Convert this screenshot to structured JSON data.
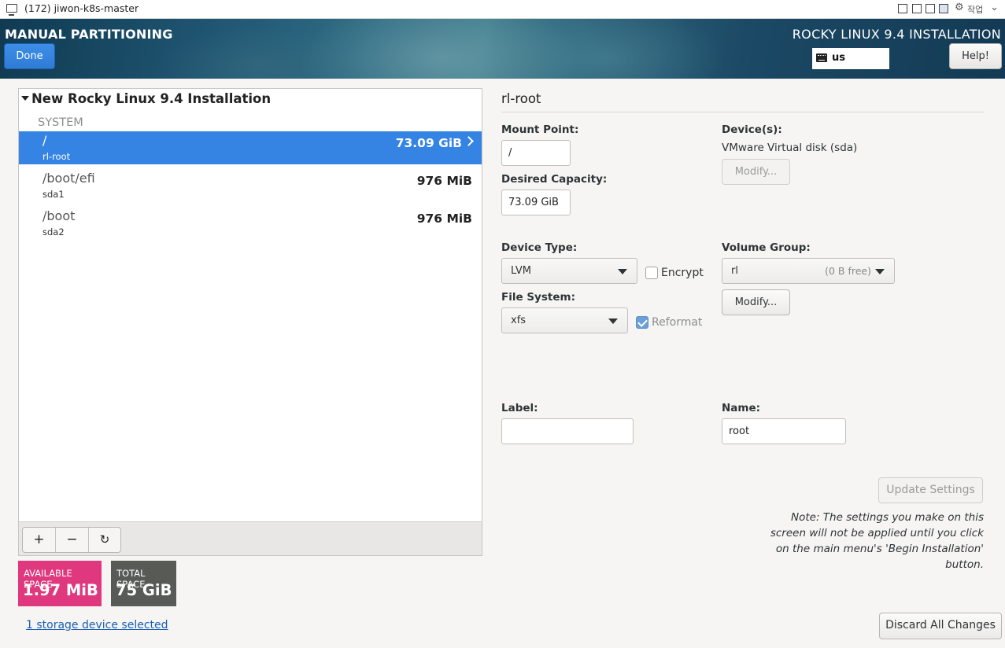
{
  "vm_window": {
    "title": "(172) jiwon-k8s-master",
    "menu_text": "작업"
  },
  "header": {
    "page_title": "MANUAL PARTITIONING",
    "done_label": "Done",
    "product_title": "ROCKY LINUX 9.4 INSTALLATION",
    "keyboard_layout": "us",
    "help_label": "Help!"
  },
  "tree": {
    "root_label": "New Rocky Linux 9.4 Installation",
    "group_label": "SYSTEM",
    "items": [
      {
        "mount": "/",
        "device": "rl-root",
        "size": "73.09 GiB",
        "selected": true
      },
      {
        "mount": "/boot/efi",
        "device": "sda1",
        "size": "976 MiB",
        "selected": false
      },
      {
        "mount": "/boot",
        "device": "sda2",
        "size": "976 MiB",
        "selected": false
      }
    ],
    "toolbar": {
      "add": "+",
      "remove": "−",
      "refresh": "↻"
    }
  },
  "space": {
    "available_label": "AVAILABLE SPACE",
    "available_value": "1.97 MiB",
    "total_label": "TOTAL SPACE",
    "total_value": "75 GiB"
  },
  "storage_link": "1 storage device selected",
  "detail": {
    "title": "rl-root",
    "mount_point_label": "Mount Point:",
    "mount_point_value": "/",
    "desired_capacity_label": "Desired Capacity:",
    "desired_capacity_value": "73.09 GiB",
    "devices_label": "Device(s):",
    "devices_value": "VMware Virtual disk (sda)",
    "devices_modify_label": "Modify...",
    "device_type_label": "Device Type:",
    "device_type_value": "LVM",
    "encrypt_label": "Encrypt",
    "encrypt_checked": false,
    "volume_group_label": "Volume Group:",
    "volume_group_value": "rl",
    "volume_group_free": "(0 B free)",
    "volume_group_modify_label": "Modify...",
    "file_system_label": "File System:",
    "file_system_value": "xfs",
    "reformat_label": "Reformat",
    "reformat_checked": true,
    "label_label": "Label:",
    "label_value": "",
    "name_label": "Name:",
    "name_value": "root",
    "update_settings_label": "Update Settings",
    "note": "Note:  The settings you make on this screen will not be applied until you click on the main menu's 'Begin Installation' button."
  },
  "discard_label": "Discard All Changes",
  "colors": {
    "selected_row": "#3584e4",
    "available_space": "#e0387e",
    "total_space": "#585a55",
    "done_button": "#3584e4",
    "link": "#1a5fb4"
  }
}
